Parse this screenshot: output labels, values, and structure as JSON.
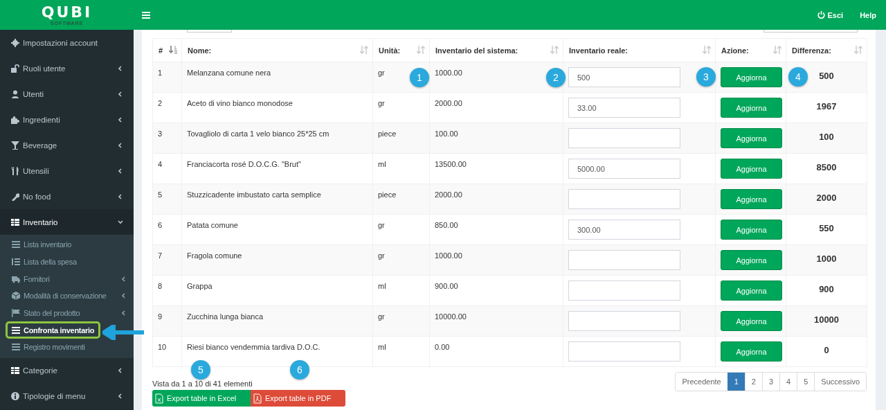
{
  "logo": {
    "name": "QUBI",
    "tagline": "SOFTWARE"
  },
  "header": {
    "actions": [
      "Esci",
      "Help"
    ]
  },
  "sidebar": {
    "items": [
      {
        "label": "Impostazioni account",
        "expandable": false,
        "expanded": false
      },
      {
        "label": "Ruoli utente",
        "expandable": true,
        "expanded": false
      },
      {
        "label": "Utenti",
        "expandable": true,
        "expanded": false
      },
      {
        "label": "Ingredienti",
        "expandable": true,
        "expanded": false
      },
      {
        "label": "Beverage",
        "expandable": true,
        "expanded": false
      },
      {
        "label": "Utensili",
        "expandable": true,
        "expanded": false
      },
      {
        "label": "No food",
        "expandable": true,
        "expanded": false
      },
      {
        "label": "Inventario",
        "expandable": true,
        "expanded": true,
        "children": [
          {
            "label": "Lista inventario",
            "expandable": false,
            "selected": false,
            "highlighted": false
          },
          {
            "label": "Lista della spesa",
            "expandable": false,
            "selected": false,
            "highlighted": false
          },
          {
            "label": "Fornitori",
            "expandable": true,
            "selected": false,
            "highlighted": false
          },
          {
            "label": "Modalità di conservazione",
            "expandable": true,
            "selected": false,
            "highlighted": false
          },
          {
            "label": "Stato del prodotto",
            "expandable": true,
            "selected": false,
            "highlighted": false
          },
          {
            "label": "Confronta inventario",
            "expandable": false,
            "selected": true,
            "highlighted": true
          },
          {
            "label": "Registro movimenti",
            "expandable": false,
            "selected": false,
            "highlighted": false
          }
        ]
      },
      {
        "label": "Categorie",
        "expandable": true,
        "expanded": false
      },
      {
        "label": "Tipologie di menu",
        "expandable": true,
        "expanded": false
      }
    ]
  },
  "table": {
    "columns": [
      {
        "label": "#",
        "sorted": true
      },
      {
        "label": "Nome:",
        "sorted": false
      },
      {
        "label": "Unità:",
        "sorted": false
      },
      {
        "label": "Inventario del sistema:",
        "sorted": false
      },
      {
        "label": "Inventario reale:",
        "sorted": false
      },
      {
        "label": "Azione:",
        "sorted": false
      },
      {
        "label": "Differenza:",
        "sorted": false
      }
    ],
    "rows": [
      {
        "n": "1",
        "name": "Melanzana comune nera",
        "unit": "gr",
        "system": "1000.00",
        "real": "500",
        "action": "Aggiorna",
        "diff": "500"
      },
      {
        "n": "2",
        "name": "Aceto di vino bianco monodose",
        "unit": "gr",
        "system": "2000.00",
        "real": "33.00",
        "action": "Aggiorna",
        "diff": "1967"
      },
      {
        "n": "3",
        "name": "Tovagliolo di carta 1 velo bianco 25*25 cm",
        "unit": "piece",
        "system": "100.00",
        "action": "Aggiorna",
        "diff": "100"
      },
      {
        "n": "4",
        "name": "Franciacorta rosé D.O.C.G. \"Brut\"",
        "unit": "ml",
        "system": "13500.00",
        "real": "5000.00",
        "action": "Aggiorna",
        "diff": "8500"
      },
      {
        "n": "5",
        "name": "Stuzzicadente imbustato carta semplice",
        "unit": "piece",
        "system": "2000.00",
        "action": "Aggiorna",
        "diff": "2000"
      },
      {
        "n": "6",
        "name": "Patata comune",
        "unit": "gr",
        "system": "850.00",
        "real": "300.00",
        "action": "Aggiorna",
        "diff": "550"
      },
      {
        "n": "7",
        "name": "Fragola comune",
        "unit": "gr",
        "system": "1000.00",
        "action": "Aggiorna",
        "diff": "1000"
      },
      {
        "n": "8",
        "name": "Grappa",
        "unit": "ml",
        "system": "900.00",
        "action": "Aggiorna",
        "diff": "900"
      },
      {
        "n": "9",
        "name": "Zucchina lunga bianca",
        "unit": "gr",
        "system": "10000.00",
        "action": "Aggiorna",
        "diff": "10000"
      },
      {
        "n": "10",
        "name": "Riesi bianco vendemmia tardiva D.O.C.",
        "unit": "ml",
        "system": "0.00",
        "action": "Aggiorna",
        "diff": "0"
      }
    ]
  },
  "info": "Vista da 1 a 10 di 41 elementi",
  "exports": [
    "Export table in Excel",
    "Export table in PDF"
  ],
  "pagination": [
    {
      "label": "Precedente",
      "selected": false
    },
    {
      "label": "1",
      "selected": true
    },
    {
      "label": "2",
      "selected": false
    },
    {
      "label": "3",
      "selected": false
    },
    {
      "label": "4",
      "selected": false
    },
    {
      "label": "5",
      "selected": false
    },
    {
      "label": "Successivo",
      "selected": false
    }
  ],
  "callouts": [
    "1",
    "2",
    "3",
    "4",
    "5",
    "6"
  ]
}
